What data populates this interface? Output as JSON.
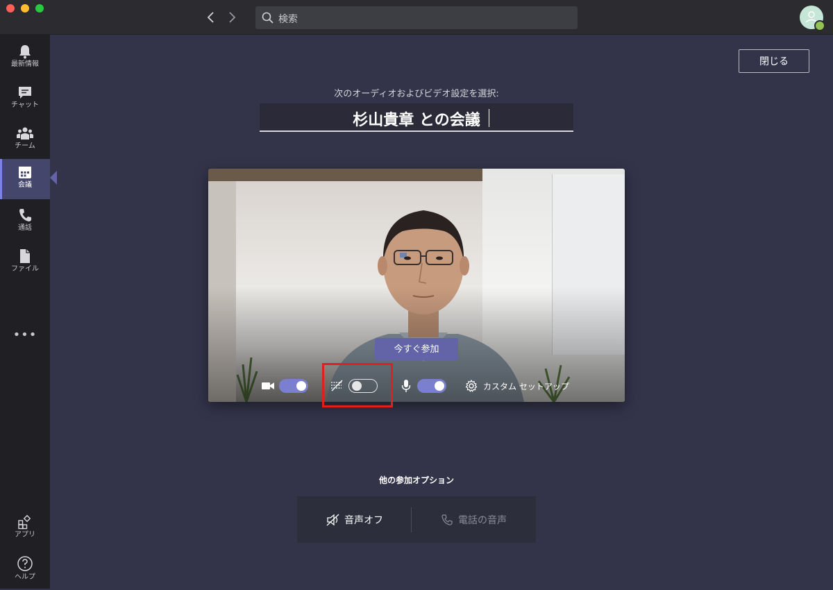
{
  "search": {
    "placeholder": "検索"
  },
  "rail": {
    "items": [
      {
        "label": "最新情報",
        "icon": "bell-icon"
      },
      {
        "label": "チャット",
        "icon": "chat-icon"
      },
      {
        "label": "チーム",
        "icon": "teams-icon"
      },
      {
        "label": "会議",
        "icon": "calendar-icon",
        "active": true
      },
      {
        "label": "通話",
        "icon": "phone-icon"
      },
      {
        "label": "ファイル",
        "icon": "file-icon"
      }
    ],
    "more": "•••",
    "bottom": [
      {
        "label": "アプリ",
        "icon": "apps-icon"
      },
      {
        "label": "ヘルプ",
        "icon": "help-icon"
      }
    ]
  },
  "main": {
    "close_label": "閉じる",
    "subtitle": "次のオーディオおよびビデオ設定を選択:",
    "meeting_title": "杉山貴章 との会議",
    "join_label": "今すぐ参加",
    "controls": {
      "camera_on": true,
      "background_blur_on": false,
      "microphone_on": true,
      "custom_setup_label": "カスタム セットアップ"
    },
    "other_options_title": "他の参加オプション",
    "audio_off_label": "音声オフ",
    "phone_audio_label": "電話の音声"
  },
  "colors": {
    "accent": "#6264a7",
    "toggle_on": "#7b7fd0",
    "highlight": "#e02020",
    "background": "#33344a"
  }
}
